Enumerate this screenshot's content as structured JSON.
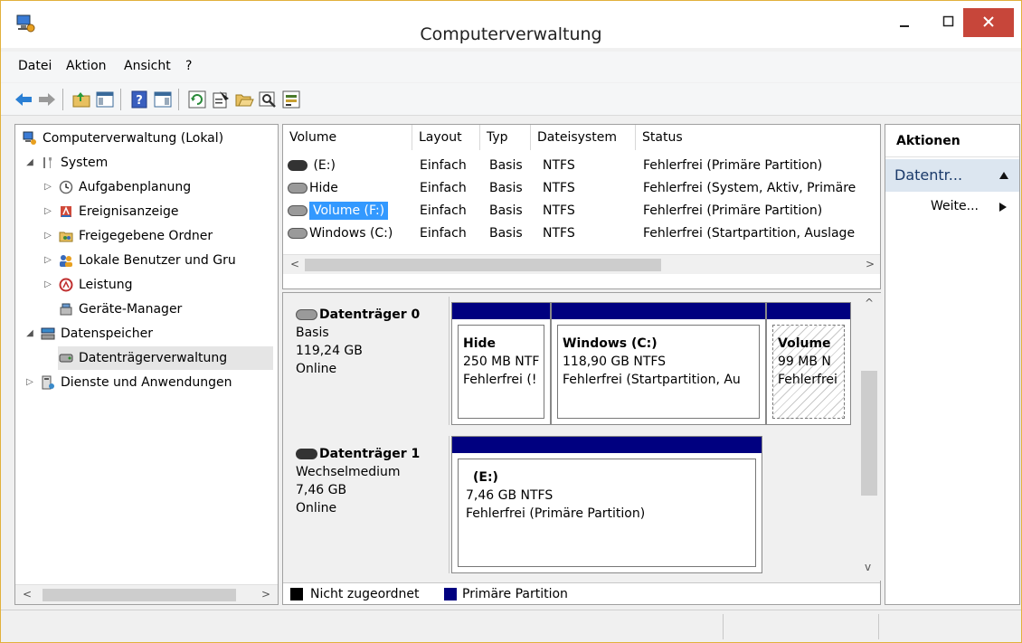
{
  "window": {
    "title": "Computerverwaltung"
  },
  "menu": [
    "Datei",
    "Aktion",
    "Ansicht",
    "?"
  ],
  "toolbar": {
    "icons": [
      "back-icon",
      "forward-icon",
      "up-folder-icon",
      "show-tree-icon",
      "help-icon",
      "show-action-pane-icon",
      "refresh-icon",
      "properties-icon",
      "open-icon",
      "search-icon",
      "disk-settings-icon"
    ]
  },
  "tree": {
    "root": "Computerverwaltung (Lokal)",
    "system": "System",
    "aufgaben": "Aufgabenplanung",
    "ereignis": "Ereignisanzeige",
    "freigegeben": "Freigegebene Ordner",
    "benutzer": "Lokale Benutzer und Gru",
    "leistung": "Leistung",
    "geraete": "Geräte-Manager",
    "datenspeicher": "Datenspeicher",
    "datentraeger": "Datenträgerverwaltung",
    "dienste": "Dienste und Anwendungen"
  },
  "list": {
    "columns": [
      "Volume",
      "Layout",
      "Typ",
      "Dateisystem",
      "Status"
    ],
    "rows": [
      {
        "volume": "(E:)",
        "layout": "Einfach",
        "typ": "Basis",
        "fs": "NTFS",
        "status": "Fehlerfrei (Primäre Partition)"
      },
      {
        "volume": "Hide",
        "layout": "Einfach",
        "typ": "Basis",
        "fs": "NTFS",
        "status": "Fehlerfrei (System, Aktiv, Primäre"
      },
      {
        "volume": "Volume (F:)",
        "layout": "Einfach",
        "typ": "Basis",
        "fs": "NTFS",
        "status": "Fehlerfrei (Primäre Partition)"
      },
      {
        "volume": "Windows (C:)",
        "layout": "Einfach",
        "typ": "Basis",
        "fs": "NTFS",
        "status": "Fehlerfrei (Startpartition, Auslage"
      }
    ]
  },
  "disks": [
    {
      "name": "Datenträger 0",
      "type": "Basis",
      "size": "119,24 GB",
      "state": "Online",
      "partitions": [
        {
          "name": "Hide",
          "size": "250 MB NTF",
          "status": "Fehlerfrei (!"
        },
        {
          "name": "Windows  (C:)",
          "size": "118,90 GB NTFS",
          "status": "Fehlerfrei (Startpartition, Au"
        },
        {
          "name": "Volume",
          "size": "99 MB N",
          "status": "Fehlerfrei"
        }
      ]
    },
    {
      "name": "Datenträger 1",
      "type": "Wechselmedium",
      "size": "7,46 GB",
      "state": "Online",
      "partitions": [
        {
          "name": "(E:)",
          "size": "7,46 GB NTFS",
          "status": "Fehlerfrei (Primäre Partition)"
        }
      ]
    }
  ],
  "legend": {
    "unallocated": "Nicht zugeordnet",
    "primary": "Primäre Partition"
  },
  "actions": {
    "title": "Aktionen",
    "section": "Datentr...",
    "more": "Weite..."
  },
  "colors": {
    "primary_partition": "#000080",
    "unallocated": "#000000",
    "selection": "#3399ff",
    "close_button": "#c7463a"
  }
}
